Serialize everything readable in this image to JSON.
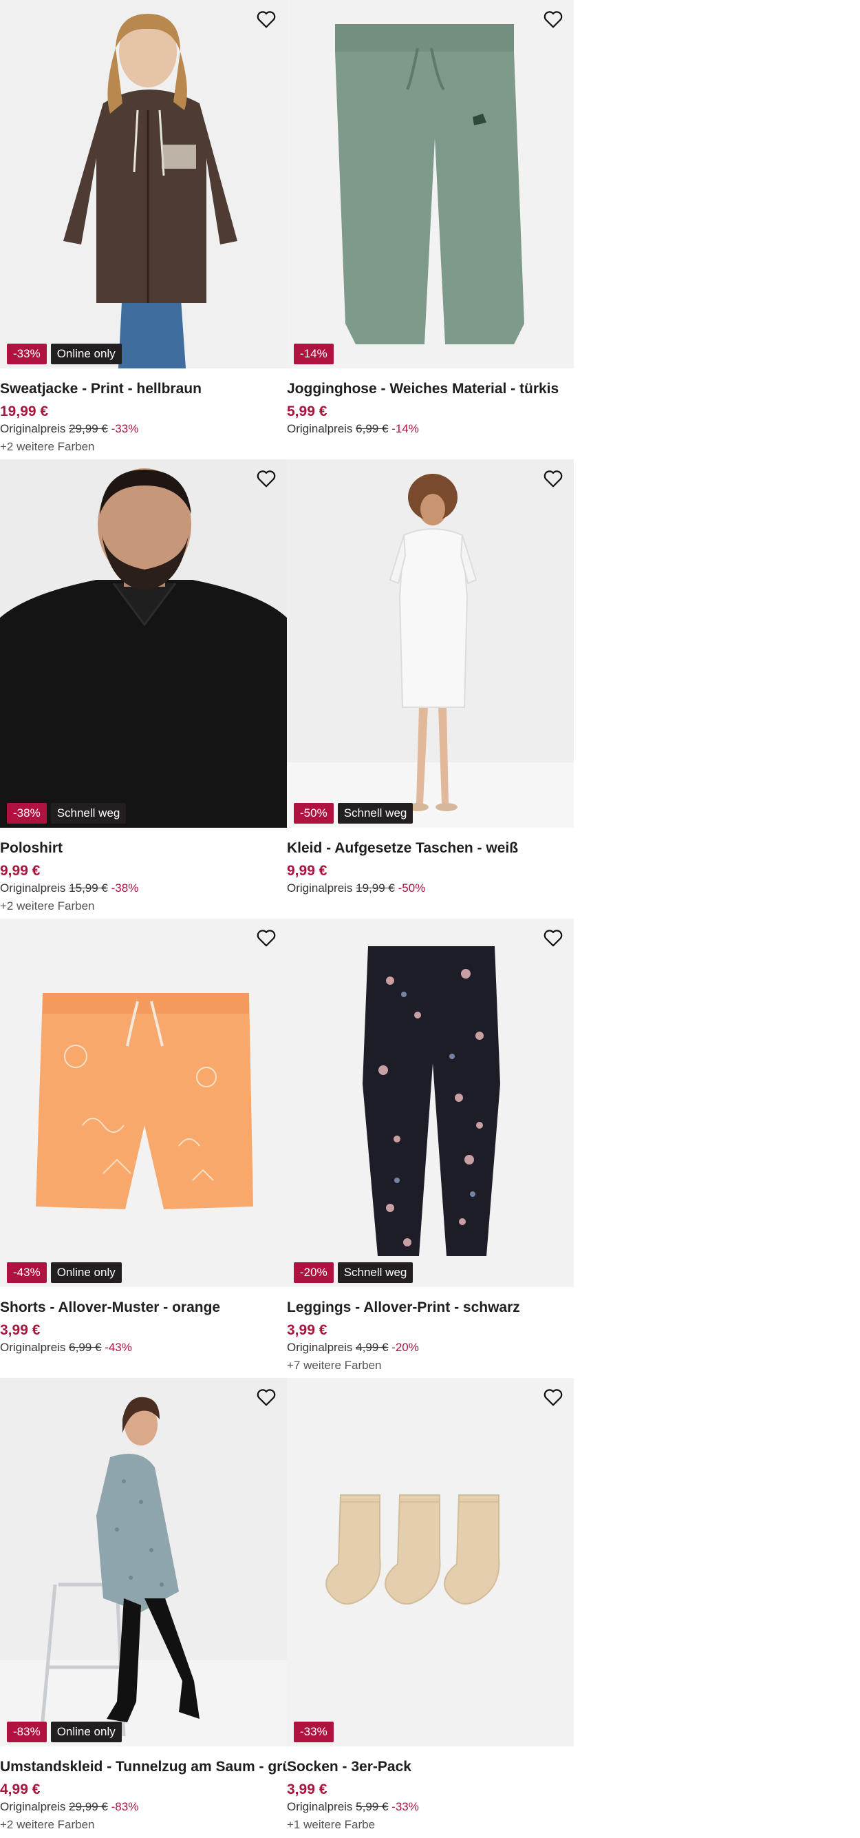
{
  "products": [
    {
      "title": "Sweatjacke - Print - hellbraun",
      "price": "19,99 €",
      "original_label": "Originalpreis",
      "original_price": "29,99 €",
      "discount": "-33%",
      "badge_discount": "-33%",
      "badge_info": "Online only",
      "colors": "+2 weitere Farben",
      "image": "brown-zip-hoodie"
    },
    {
      "title": "Jogginghose - Weiches Material - türkis",
      "price": "5,99 €",
      "original_label": "Originalpreis",
      "original_price": "6,99 €",
      "discount": "-14%",
      "badge_discount": "-14%",
      "badge_info": "",
      "colors": "",
      "image": "green-joggers"
    },
    {
      "title": "Poloshirt",
      "price": "9,99 €",
      "original_label": "Originalpreis",
      "original_price": "15,99 €",
      "discount": "-38%",
      "badge_discount": "-38%",
      "badge_info": "Schnell weg",
      "colors": "+2 weitere Farben",
      "image": "black-polo"
    },
    {
      "title": "Kleid - Aufgesetze Taschen - weiß",
      "price": "9,99 €",
      "original_label": "Originalpreis",
      "original_price": "19,99 €",
      "discount": "-50%",
      "badge_discount": "-50%",
      "badge_info": "Schnell weg",
      "colors": "",
      "image": "white-dress"
    },
    {
      "title": "Shorts - Allover-Muster - orange",
      "price": "3,99 €",
      "original_label": "Originalpreis",
      "original_price": "6,99 €",
      "discount": "-43%",
      "badge_discount": "-43%",
      "badge_info": "Online only",
      "colors": "",
      "image": "orange-shorts"
    },
    {
      "title": "Leggings - Allover-Print - schwarz",
      "price": "3,99 €",
      "original_label": "Originalpreis",
      "original_price": "4,99 €",
      "discount": "-20%",
      "badge_discount": "-20%",
      "badge_info": "Schnell weg",
      "colors": "+7 weitere Farben",
      "image": "floral-leggings"
    },
    {
      "title": "Umstandskleid - Tunnelzug am Saum - grün",
      "price": "4,99 €",
      "original_label": "Originalpreis",
      "original_price": "29,99 €",
      "discount": "-83%",
      "badge_discount": "-83%",
      "badge_info": "Online only",
      "colors": "+2 weitere Farben",
      "image": "maternity-dress"
    },
    {
      "title": "Socken - 3er-Pack",
      "price": "3,99 €",
      "original_label": "Originalpreis",
      "original_price": "5,99 €",
      "discount": "-33%",
      "badge_discount": "-33%",
      "badge_info": "",
      "colors": "+1 weitere Farbe",
      "image": "beige-socks"
    }
  ],
  "icons": {
    "favorite": "heart-outline-icon"
  },
  "colors": {
    "accent": "#a8153d",
    "badge_discount": "#b0123f",
    "badge_info": "#231f20",
    "image_bg": "#f2f2f2"
  }
}
